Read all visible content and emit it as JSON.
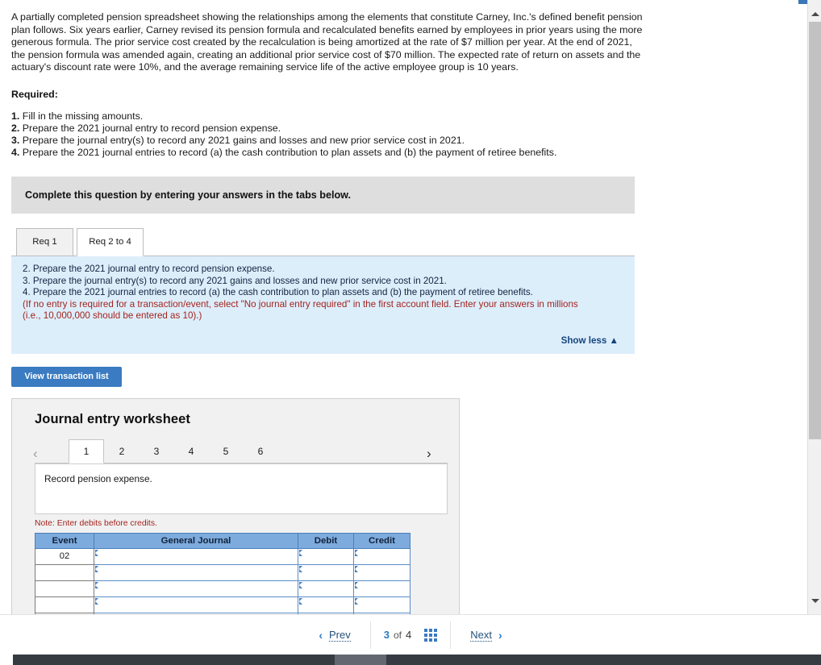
{
  "question": {
    "intro": "A partially completed pension spreadsheet showing the relationships among the elements that constitute Carney, Inc.'s defined benefit pension plan follows. Six years earlier, Carney revised its pension formula and recalculated benefits earned by employees in prior years using the more generous formula. The prior service cost created by the recalculation is being amortized at the rate of $7 million per year. At the end of 2021, the pension formula was amended again, creating an additional prior service cost of $70 million. The expected rate of return on assets and the actuary's discount rate were 10%, and the average remaining service life of the active employee group is 10 years.",
    "required_label": "Required:",
    "requirements": [
      {
        "num": "1.",
        "text": "Fill in the missing amounts."
      },
      {
        "num": "2.",
        "text": "Prepare the 2021 journal entry to record pension expense."
      },
      {
        "num": "3.",
        "text": "Prepare the journal entry(s) to record any 2021 gains and losses and new prior service cost in 2021."
      },
      {
        "num": "4.",
        "text": "Prepare the 2021 journal entries to record (a) the cash contribution to plan assets and (b) the payment of retiree benefits."
      }
    ]
  },
  "banner": {
    "text": "Complete this question by entering your answers in the tabs below."
  },
  "tabs": [
    {
      "label": "Req 1",
      "active": false
    },
    {
      "label": "Req 2 to 4",
      "active": true
    }
  ],
  "instructions": {
    "lines": [
      "2. Prepare the 2021 journal entry to record pension expense.",
      "3. Prepare the journal entry(s) to record any 2021 gains and losses and new prior service cost in 2021.",
      "4. Prepare the 2021 journal entries to record (a) the cash contribution to plan assets and (b) the payment of retiree benefits."
    ],
    "red_lines": [
      "(If no entry is required for a transaction/event, select \"No journal entry required\" in the first account field. Enter your answers in millions",
      "(i.e., 10,000,000 should be entered as 10).)"
    ],
    "show_less": "Show less ▲"
  },
  "toolbar": {
    "view_transaction_list": "View transaction list"
  },
  "worksheet": {
    "title": "Journal entry worksheet",
    "prev_icon": "chevron-left-icon",
    "next_icon": "chevron-right-icon",
    "pages": [
      {
        "label": "1",
        "active": true
      },
      {
        "label": "2",
        "active": false
      },
      {
        "label": "3",
        "active": false
      },
      {
        "label": "4",
        "active": false
      },
      {
        "label": "5",
        "active": false
      },
      {
        "label": "6",
        "active": false
      }
    ],
    "description": "Record pension expense.",
    "note": "Note: Enter debits before credits.",
    "table": {
      "headers": [
        "Event",
        "General Journal",
        "Debit",
        "Credit"
      ],
      "rows": [
        {
          "event": "02",
          "general_journal": "",
          "debit": "",
          "credit": ""
        },
        {
          "event": "",
          "general_journal": "",
          "debit": "",
          "credit": ""
        },
        {
          "event": "",
          "general_journal": "",
          "debit": "",
          "credit": ""
        },
        {
          "event": "",
          "general_journal": "",
          "debit": "",
          "credit": ""
        },
        {
          "event": "",
          "general_journal": "",
          "debit": "",
          "credit": ""
        }
      ]
    }
  },
  "bottom_nav": {
    "prev_label": "Prev",
    "next_label": "Next",
    "prev_arrow": "‹",
    "next_arrow": "›",
    "page_current": "3",
    "page_of": "of",
    "page_total": "4",
    "grid_icon": "grid-view-icon"
  },
  "colors": {
    "accent_blue": "#3a7bc1",
    "panel_blue": "#ddeefb",
    "table_header_blue": "#7eabdd",
    "red_text": "#a3231e",
    "link_blue": "#23527c"
  }
}
